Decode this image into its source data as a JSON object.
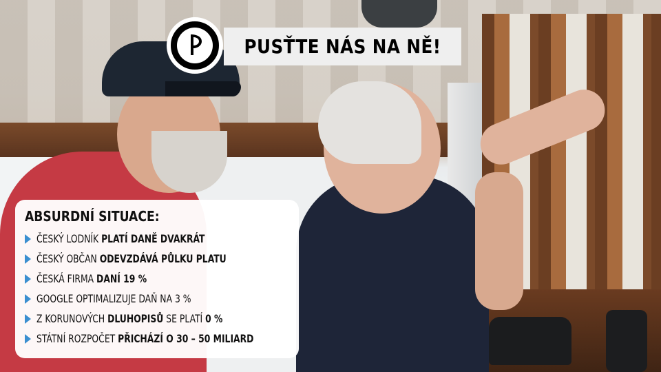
{
  "headline": "PUSŤTE NÁS NA NĚ!",
  "infobox": {
    "title": "ABSURDNÍ SITUACE:",
    "items": [
      {
        "parts": [
          {
            "text": "ČESKÝ LODNÍK ",
            "bold": false
          },
          {
            "text": "PLATÍ DANĚ DVAKRÁT",
            "bold": true
          }
        ]
      },
      {
        "parts": [
          {
            "text": "ČESKÝ OBČAN ",
            "bold": false
          },
          {
            "text": "ODEVZDÁVÁ PŮLKU PLATU",
            "bold": true
          }
        ]
      },
      {
        "parts": [
          {
            "text": "ČESKÁ FIRMA ",
            "bold": false
          },
          {
            "text": "DANÍ 19 %",
            "bold": true
          }
        ]
      },
      {
        "parts": [
          {
            "text": "GOOGLE OPTIMALIZUJE DAŇ NA 3 %",
            "bold": false
          }
        ]
      },
      {
        "parts": [
          {
            "text": "Z KORUNOVÝCH ",
            "bold": false
          },
          {
            "text": "DLUHOPISŮ",
            "bold": true
          },
          {
            "text": " SE PLATÍ ",
            "bold": false
          },
          {
            "text": "0 %",
            "bold": true
          }
        ]
      },
      {
        "parts": [
          {
            "text": "STÁTNÍ ROZPOČET ",
            "bold": false
          },
          {
            "text": "PŘICHÁZÍ O 30 – 50 MILIARD",
            "bold": true
          }
        ]
      }
    ]
  },
  "icons": {
    "logo": "pirate-flag-icon",
    "bullet": "triangle-bullet-icon"
  },
  "colors": {
    "bullet": "#3a8fd0",
    "headline_bg": "#efefef",
    "box_bg": "#ffffff"
  }
}
